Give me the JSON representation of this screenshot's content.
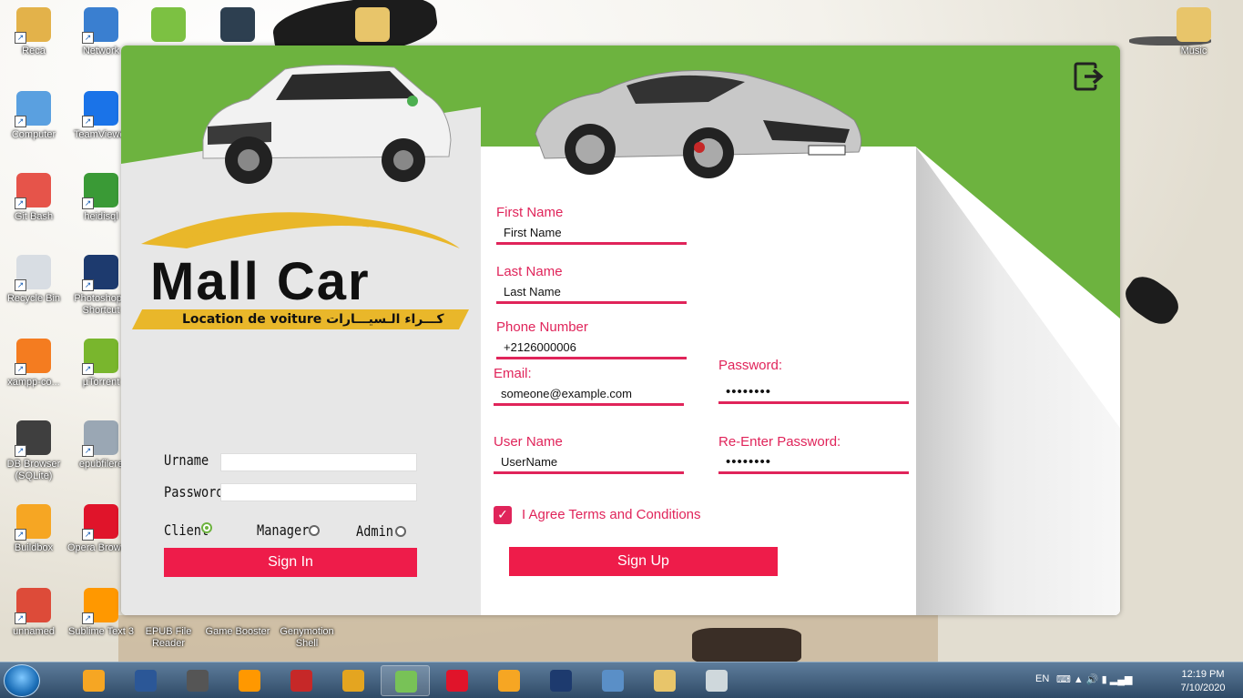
{
  "desktop": {
    "icons_left": [
      {
        "label": "Reca",
        "icon": "user-folder-icon",
        "color": "#e3b24a"
      },
      {
        "label": "Network",
        "icon": "network-globe-icon",
        "color": "#3a7fd0"
      },
      {
        "label": "Computer",
        "icon": "computer-icon",
        "color": "#5aa0e0"
      },
      {
        "label": "TeamViewer",
        "icon": "teamviewer-icon",
        "color": "#1a73e8"
      },
      {
        "label": "Git Bash",
        "icon": "git-bash-icon",
        "color": "#e6544a"
      },
      {
        "label": "heidisql",
        "icon": "heidisql-icon",
        "color": "#3a9a36"
      },
      {
        "label": "Recycle Bin",
        "icon": "recycle-bin-icon",
        "color": "#d8dde3"
      },
      {
        "label": "Photoshop - Shortcut",
        "icon": "photoshop-icon",
        "color": "#1d3a6e"
      },
      {
        "label": "xampp-co...",
        "icon": "xampp-icon",
        "color": "#f47c20"
      },
      {
        "label": "µTorrent",
        "icon": "utorrent-icon",
        "color": "#79b62d"
      },
      {
        "label": "DB Browser (SQLite)",
        "icon": "db-browser-icon",
        "color": "#3f3f3f"
      },
      {
        "label": "epubfilere",
        "icon": "epub-reader-icon",
        "color": "#9aa7b4"
      },
      {
        "label": "Buildbox",
        "icon": "buildbox-icon",
        "color": "#f6a623"
      },
      {
        "label": "Opera Browser",
        "icon": "opera-icon",
        "color": "#e0142a"
      },
      {
        "label": "unnamed",
        "icon": "chrome-icon",
        "color": "#dd4b39"
      },
      {
        "label": "Sublime Text 3",
        "icon": "sublime-icon",
        "color": "#ff9800"
      }
    ],
    "icons_bottom": [
      {
        "label": "EPUB File Reader",
        "icon": "epub-file-reader-icon"
      },
      {
        "label": "Game Booster",
        "icon": "game-booster-icon"
      },
      {
        "label": "Genymotion Shell",
        "icon": "genymotion-icon"
      }
    ],
    "icons_top": [
      {
        "label": "",
        "icon": "add-green-icon"
      },
      {
        "label": "",
        "icon": "filmora-icon"
      },
      {
        "label": "",
        "icon": "folder-icon"
      }
    ],
    "icon_right": {
      "label": "Music",
      "icon": "music-folder-icon"
    }
  },
  "app": {
    "brand_name": "Mall Car",
    "brand_tagline": "Location de voiture  كـــراء الـسيـــارات",
    "login": {
      "username_label": "Urname",
      "password_label": "Password",
      "roles": [
        {
          "label": "Client",
          "selected": true
        },
        {
          "label": "Manager",
          "selected": false
        },
        {
          "label": "Admin",
          "selected": false
        }
      ],
      "sign_in": "Sign In"
    },
    "signup": {
      "first_name_label": "First Name",
      "first_name_value": "First Name",
      "last_name_label": "Last Name",
      "last_name_value": "Last Name",
      "phone_label": "Phone Number",
      "phone_value": "+2126000006",
      "email_label": "Email:",
      "email_value": "someone@example.com",
      "username_label": "User Name",
      "username_value": "UserName",
      "password_label": "Password:",
      "password_value": "••••••••",
      "repassword_label": "Re-Enter Password:",
      "repassword_value": "••••••••",
      "agree_label": "I Agree Terms and Conditions",
      "agree_checked": true,
      "sign_up": "Sign Up"
    },
    "colors": {
      "accent": "#e0245a",
      "button": "#ee1c4a",
      "green": "#6db33f",
      "logo_yellow": "#e9b72a"
    }
  },
  "taskbar": {
    "apps": [
      "buildbox",
      "word",
      "device-manager",
      "sublime",
      "321-player",
      "ccleaner",
      "android-studio",
      "opera",
      "buildbox",
      "photoshop",
      "image-viewer",
      "file-explorer",
      "desktop-app"
    ],
    "language": "EN",
    "time": "12:19 PM",
    "date": "7/10/2020"
  }
}
